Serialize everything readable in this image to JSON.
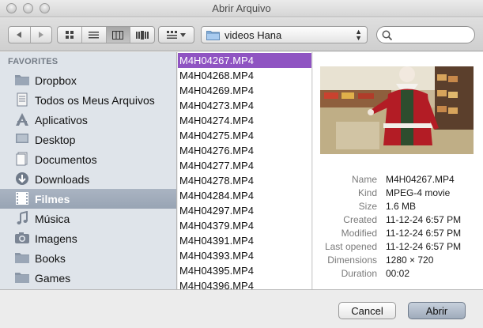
{
  "window": {
    "title": "Abrir Arquivo"
  },
  "toolbar": {
    "location": "videos Hana",
    "search_placeholder": ""
  },
  "sidebar": {
    "header": "FAVORITES",
    "items": [
      {
        "label": "Dropbox",
        "icon": "folder-icon"
      },
      {
        "label": "Todos os Meus Arquivos",
        "icon": "all-files-icon"
      },
      {
        "label": "Aplicativos",
        "icon": "applications-icon"
      },
      {
        "label": "Desktop",
        "icon": "desktop-icon"
      },
      {
        "label": "Documentos",
        "icon": "documents-icon"
      },
      {
        "label": "Downloads",
        "icon": "downloads-icon"
      },
      {
        "label": "Filmes",
        "icon": "movies-icon",
        "selected": true
      },
      {
        "label": "Música",
        "icon": "music-icon"
      },
      {
        "label": "Imagens",
        "icon": "pictures-icon"
      },
      {
        "label": "Books",
        "icon": "folder-icon"
      },
      {
        "label": "Games",
        "icon": "folder-icon"
      }
    ]
  },
  "files": [
    "M4H04267.MP4",
    "M4H04268.MP4",
    "M4H04269.MP4",
    "M4H04273.MP4",
    "M4H04274.MP4",
    "M4H04275.MP4",
    "M4H04276.MP4",
    "M4H04277.MP4",
    "M4H04278.MP4",
    "M4H04284.MP4",
    "M4H04297.MP4",
    "M4H04379.MP4",
    "M4H04391.MP4",
    "M4H04393.MP4",
    "M4H04395.MP4",
    "M4H04396.MP4"
  ],
  "selected_file_index": 0,
  "preview": {
    "info": [
      {
        "key": "Name",
        "value": "M4H04267.MP4"
      },
      {
        "key": "Kind",
        "value": "MPEG-4 movie"
      },
      {
        "key": "Size",
        "value": "1.6 MB"
      },
      {
        "key": "Created",
        "value": "11-12-24 6:57 PM"
      },
      {
        "key": "Modified",
        "value": "11-12-24 6:57 PM"
      },
      {
        "key": "Last opened",
        "value": "11-12-24 6:57 PM"
      },
      {
        "key": "Dimensions",
        "value": "1280 × 720"
      },
      {
        "key": "Duration",
        "value": "00:02"
      }
    ]
  },
  "buttons": {
    "cancel": "Cancel",
    "open": "Abrir"
  },
  "colors": {
    "selection": "#8f54c2",
    "sidebar_selected": "#9fabba",
    "sidebar_bg": "#dfe4ea"
  }
}
